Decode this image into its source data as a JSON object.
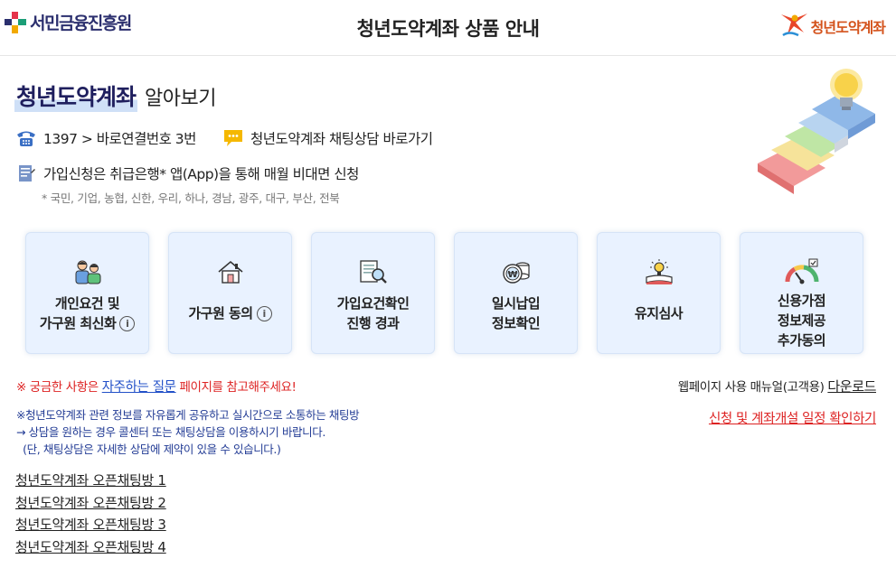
{
  "header": {
    "left_logo_text": "서민금융진흥원",
    "title": "청년도약계좌 상품 안내",
    "right_logo_text": "청년도약계좌"
  },
  "intro": {
    "title_strong": "청년도약계좌",
    "title_rest": "알아보기",
    "phone_text": "1397 > 바로연결번호 3번",
    "chat_text": "청년도약계좌 채팅상담 바로가기",
    "apply_text": "가입신청은 취급은행* 앱(App)을 통해 매월 비대면 신청",
    "banks_note": "* 국민, 기업, 농협, 신한, 우리, 하나, 경남, 광주, 대구, 부산, 전북"
  },
  "cards": [
    {
      "line1": "개인요건 및",
      "line2": "가구원 최신화",
      "line3": "",
      "icon": "people-icon"
    },
    {
      "line1": "가구원 동의",
      "line2": "",
      "line3": "",
      "icon": "house-icon"
    },
    {
      "line1": "가입요건확인",
      "line2": "진행 경과",
      "line3": "",
      "icon": "document-search-icon"
    },
    {
      "line1": "일시납입",
      "line2": "정보확인",
      "line3": "",
      "icon": "coin-icon"
    },
    {
      "line1": "유지심사",
      "line2": "",
      "line3": "",
      "icon": "lightbulb-book-icon"
    },
    {
      "line1": "신용가점",
      "line2": "정보제공",
      "line3": "추가동의",
      "icon": "credit-gauge-icon"
    }
  ],
  "info_symbol": "i",
  "faq": {
    "prefix": "※ 궁금한 사항은 ",
    "link": "자주하는 질문",
    "suffix": " 페이지를 참고해주세요!"
  },
  "manual": {
    "text": "웹페이지 사용 매뉴얼(고객용) ",
    "link": "다운로드"
  },
  "schedule_link": "신청 및 계좌개설 일정 확인하기",
  "chat_note": [
    "※청년도약계좌 관련 정보를 자유롭게 공유하고 실시간으로 소통하는 채팅방",
    "→ 상담을 원하는 경우 콜센터 또는 채팅상담을 이용하시기 바랍니다.",
    "  (단, 채팅상담은 자세한 상담에 제약이 있을 수 있습니다.)"
  ],
  "open_chats": [
    "청년도약계좌 오픈채팅방 1",
    "청년도약계좌 오픈채팅방 2",
    "청년도약계좌 오픈채팅방 3",
    "청년도약계좌 오픈채팅방 4"
  ],
  "colors": {
    "brand_navy": "#2b2f6e",
    "accent_red": "#d22222",
    "link_blue": "#2250c8",
    "card_bg": "#e9f2ff",
    "orange": "#d4531c"
  }
}
